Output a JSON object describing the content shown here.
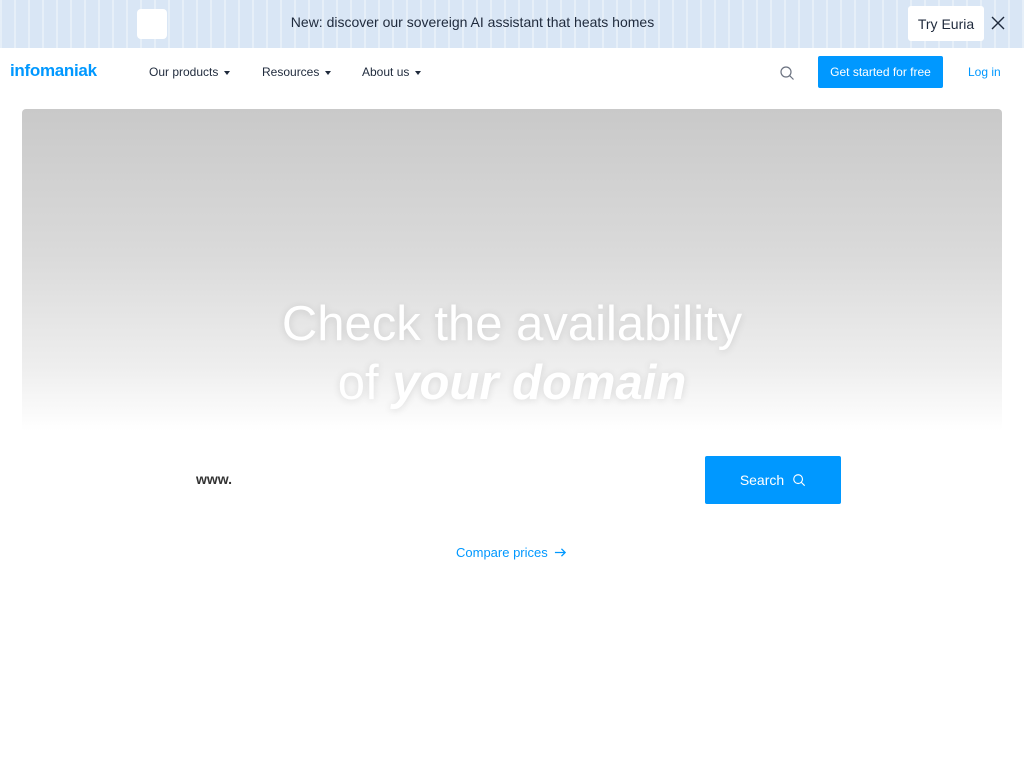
{
  "banner": {
    "message": "New: discover our sovereign AI assistant that heats homes",
    "cta_label": "Try Euria",
    "close_icon": "close-icon"
  },
  "nav": {
    "logo": "infomaniak",
    "items": [
      {
        "label": "Our products"
      },
      {
        "label": "Resources"
      },
      {
        "label": "About us"
      }
    ],
    "search_icon": "search-icon",
    "cta_label": "Get started for free",
    "login_label": "Log in"
  },
  "hero": {
    "title_line1": "Check the availability",
    "title_line2_plain": "of",
    "title_line2_emphasis": "your domain"
  },
  "domain_search": {
    "prefix": "www.",
    "input_value": "",
    "button_label": "Search",
    "button_icon": "search-icon"
  },
  "compare": {
    "label": "Compare prices",
    "icon": "arrow-right-icon"
  },
  "colors": {
    "accent": "#0098ff",
    "banner_bg": "#d9e6f5",
    "text_dark": "#1f2a3c"
  }
}
